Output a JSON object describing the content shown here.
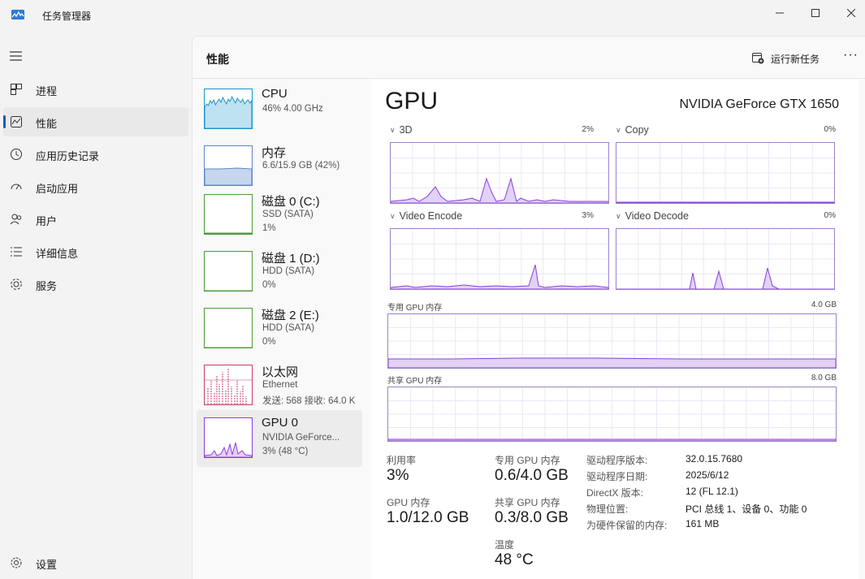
{
  "window": {
    "title": "任务管理器",
    "controls": [
      "minimize-icon",
      "maximize-icon",
      "close-icon"
    ]
  },
  "sidebar": {
    "items": [
      {
        "label": "进程",
        "icon": "processes-icon"
      },
      {
        "label": "性能",
        "icon": "performance-icon",
        "active": true
      },
      {
        "label": "应用历史记录",
        "icon": "app-history-icon"
      },
      {
        "label": "启动应用",
        "icon": "startup-icon"
      },
      {
        "label": "用户",
        "icon": "users-icon"
      },
      {
        "label": "详细信息",
        "icon": "details-icon"
      },
      {
        "label": "服务",
        "icon": "services-icon"
      }
    ],
    "settings_label": "设置"
  },
  "header": {
    "title": "性能",
    "run_task_label": "运行新任务",
    "more_label": "···"
  },
  "devices": [
    {
      "name": "CPU",
      "sub1": "46% 4.00 GHz",
      "sub2": "",
      "color": "#1f93c8"
    },
    {
      "name": "内存",
      "sub1": "6.6/15.9 GB (42%)",
      "sub2": "",
      "color": "#5c87c5"
    },
    {
      "name": "磁盘 0 (C:)",
      "sub1": "SSD (SATA)",
      "sub2": "1%",
      "color": "#4f9a3a"
    },
    {
      "name": "磁盘 1 (D:)",
      "sub1": "HDD (SATA)",
      "sub2": "0%",
      "color": "#4f9a3a"
    },
    {
      "name": "磁盘 2 (E:)",
      "sub1": "HDD (SATA)",
      "sub2": "0%",
      "color": "#4f9a3a"
    },
    {
      "name": "以太网",
      "sub1": "Ethernet",
      "sub2": "发送: 568 接收: 64.0 K",
      "color": "#c73b6e"
    },
    {
      "name": "GPU 0",
      "sub1": "NVIDIA GeForce...",
      "sub2": "3% (48 °C)",
      "color": "#8b3fd9",
      "active": true
    }
  ],
  "gpu": {
    "title": "GPU",
    "model": "NVIDIA GeForce GTX 1650",
    "engines": [
      {
        "label": "3D",
        "pct": "2%"
      },
      {
        "label": "Copy",
        "pct": "0%"
      },
      {
        "label": "Video Encode",
        "pct": "3%"
      },
      {
        "label": "Video Decode",
        "pct": "0%"
      }
    ],
    "dedicated_mem_label": "专用 GPU 内存",
    "dedicated_mem_max": "4.0 GB",
    "shared_mem_label": "共享 GPU 内存",
    "shared_mem_max": "8.0 GB",
    "stats": {
      "utilization_label": "利用率",
      "utilization_value": "3%",
      "gpu_mem_label": "GPU 内存",
      "gpu_mem_value": "1.0/12.0 GB",
      "dedicated_label": "专用 GPU 内存",
      "dedicated_value": "0.6/4.0 GB",
      "shared_label": "共享 GPU 内存",
      "shared_value": "0.3/8.0 GB",
      "temp_label": "温度",
      "temp_value": "48 °C"
    },
    "info": [
      {
        "key": "驱动程序版本:",
        "value": "32.0.15.7680"
      },
      {
        "key": "驱动程序日期:",
        "value": "2025/6/12"
      },
      {
        "key": "DirectX 版本:",
        "value": "12 (FL 12.1)"
      },
      {
        "key": "物理位置:",
        "value": "PCI 总线 1、设备 0、功能 0"
      },
      {
        "key": "为硬件保留的内存:",
        "value": "161 MB"
      }
    ]
  },
  "colors": {
    "accent": "#005fb8",
    "gpu_line": "#8b3fd9",
    "gpu_fill": "#e2d2f5",
    "graph_border": "#9a83c7"
  }
}
